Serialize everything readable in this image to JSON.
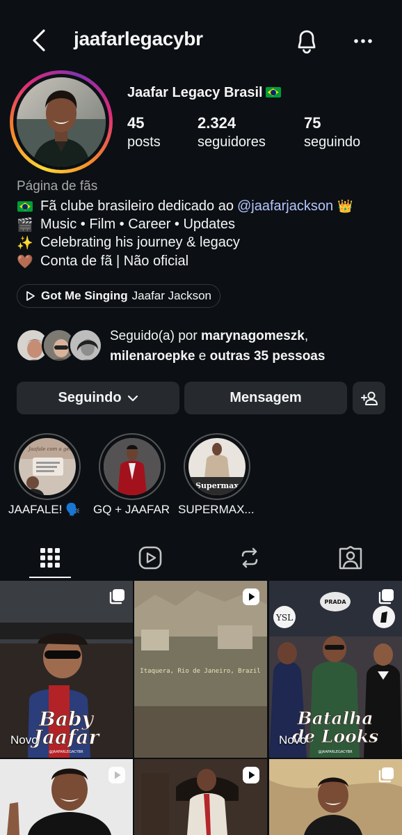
{
  "header": {
    "username": "jaafarlegacybr",
    "icons": [
      "back-arrow-icon",
      "bell-icon",
      "more-icon"
    ]
  },
  "profile": {
    "display_name": "Jaafar Legacy Brasil",
    "stats": [
      {
        "value": "45",
        "label": "posts"
      },
      {
        "value": "2.324",
        "label": "seguidores"
      },
      {
        "value": "75",
        "label": "seguindo"
      }
    ],
    "category": "Página de fãs",
    "bio": {
      "line1_pre": "Fã clube brasileiro dedicado ao ",
      "line1_mention": "@jaafarjackson",
      "line1_emoji": "👑",
      "line2": "Music • Film • Career • Updates",
      "line2_emoji": "🎬",
      "line3": "Celebrating his journey & legacy",
      "line3_emoji": "✨",
      "line4": "Conta de fã | Não oficial",
      "line4_emoji": "🤎"
    },
    "music": {
      "song": "Got Me Singing",
      "artist": "Jaafar Jackson"
    }
  },
  "followed_by": {
    "prefix": "Seguido(a) por ",
    "user1": "marynagomeszk",
    "sep": ",",
    "user2": "milenaroepke",
    "conj": " e ",
    "others": "outras 35 pessoas"
  },
  "actions": {
    "following_label": "Seguindo",
    "message_label": "Mensagem"
  },
  "highlights": [
    {
      "label": "JAAFALE! 🗣️",
      "cover_text": "Jaafale com a gente!"
    },
    {
      "label": "GQ + JAAFAR"
    },
    {
      "label": "SUPERMAX...",
      "cover_text": "Supermax"
    }
  ],
  "tabs": [
    "grid-icon",
    "reels-icon",
    "reposts-icon",
    "tagged-icon"
  ],
  "posts": [
    {
      "title": "Baby Jaafar",
      "credit": "@JAAFARLEGACYBR",
      "badge": "Novo",
      "type": "carousel"
    },
    {
      "caption": "Itaquera, Rio de Janeiro, Brazil",
      "type": "reel"
    },
    {
      "title": "Batalha de Looks",
      "credit": "@JAAFARLEGACYBR",
      "badge": "Novo",
      "type": "carousel",
      "brand": "PRADA"
    },
    {
      "type": "reel"
    },
    {
      "type": "reel"
    },
    {
      "type": "carousel"
    }
  ],
  "colors": {
    "background": "#0c1014",
    "button": "#262a2f",
    "mention": "#b4c5ff",
    "secondary_text": "#a8a8a8"
  }
}
